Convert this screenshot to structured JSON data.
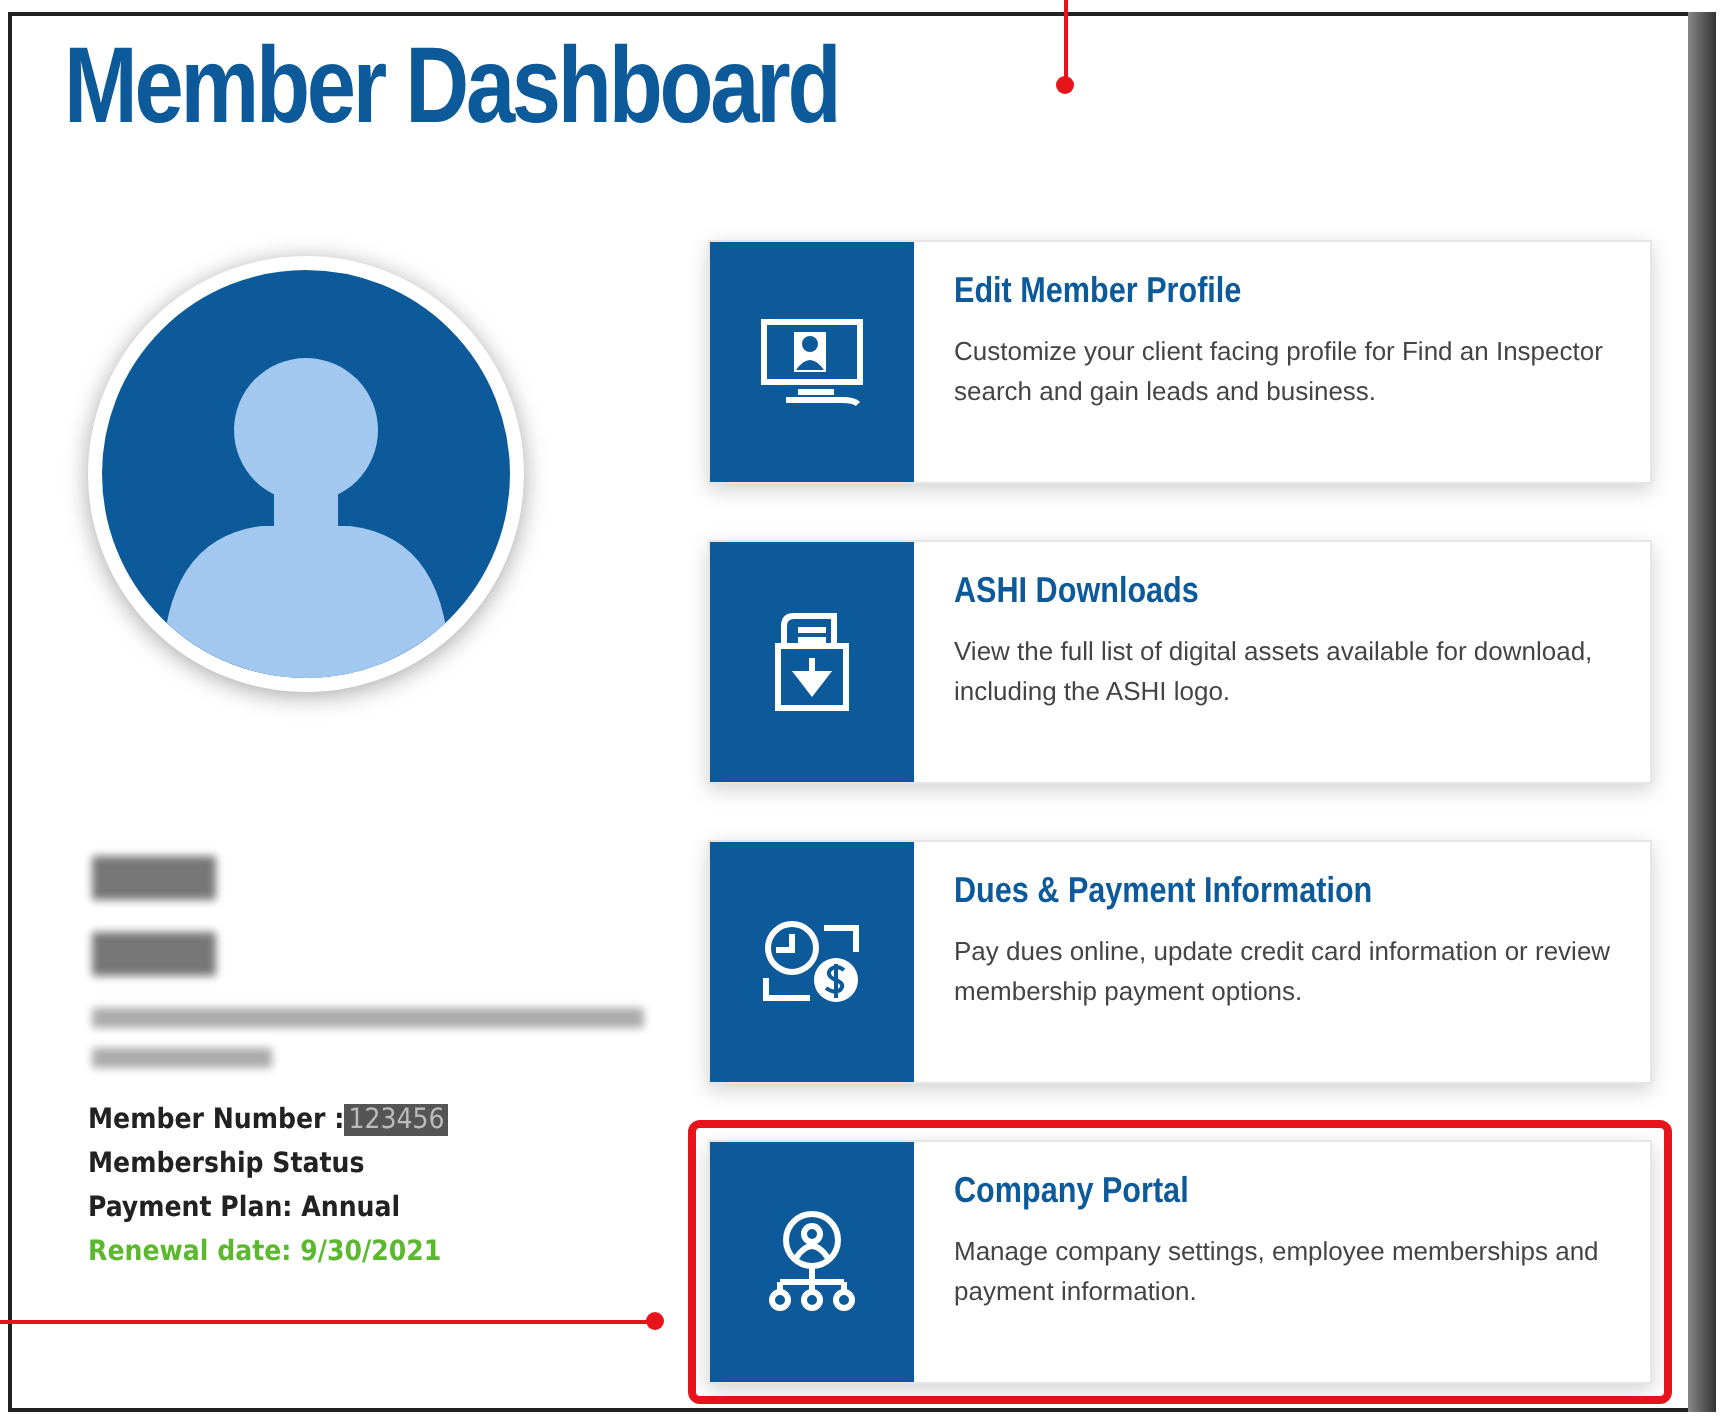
{
  "title": "Member Dashboard",
  "member": {
    "number_label": "Member Number :",
    "number": "123456",
    "status": "Membership Status",
    "plan": "Payment Plan: Annual",
    "renewal": "Renewal date: 9/30/2021"
  },
  "cards": [
    {
      "kind": "profile",
      "title": "Edit Member Profile",
      "description": "Customize your client facing profile for Find an Inspector search and gain leads and business.",
      "highlighted": false
    },
    {
      "kind": "downloads",
      "title": "ASHI Downloads",
      "description": "View the full list of digital assets available for download, including the ASHI logo.",
      "highlighted": false
    },
    {
      "kind": "dues",
      "title": "Dues & Payment Information",
      "description": "Pay dues online, update credit card information or review membership payment options.",
      "highlighted": false
    },
    {
      "kind": "company",
      "title": "Company Portal",
      "description": "Manage company settings, employee memberships and payment information.",
      "highlighted": true
    }
  ]
}
